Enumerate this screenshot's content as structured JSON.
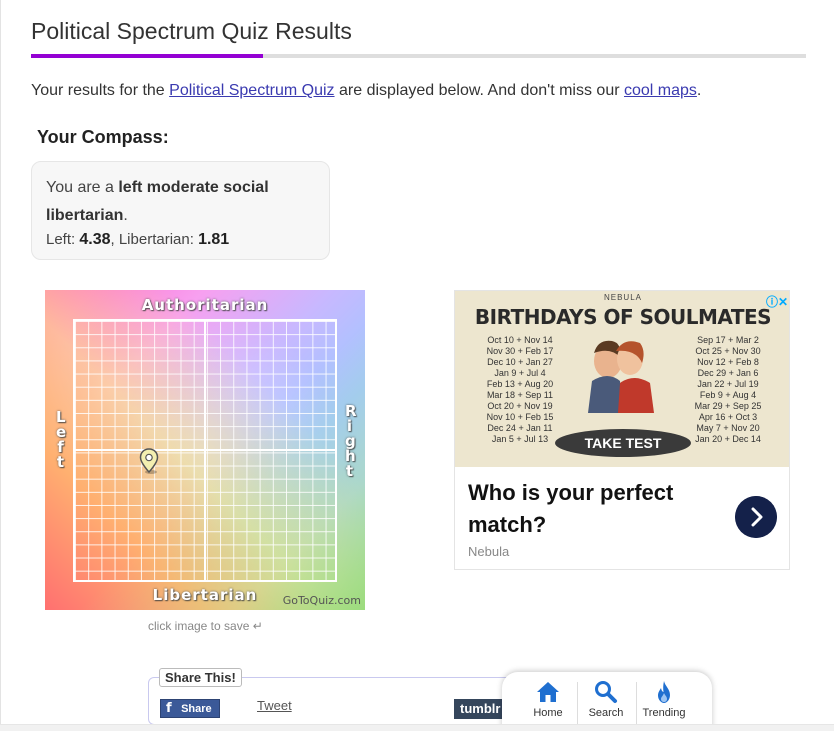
{
  "page": {
    "title": "Political Spectrum Quiz Results",
    "intro_before": "Your results for the ",
    "intro_link1": "Political Spectrum Quiz",
    "intro_middle": " are displayed below. And don't miss our ",
    "intro_link2": "cool maps",
    "intro_after": "."
  },
  "compass": {
    "heading": "Your Compass:",
    "result_prefix": "You are a ",
    "result_bold": "left moderate social libertarian",
    "result_suffix": ".",
    "left_label": "Left: ",
    "left_value": "4.38",
    "sep": ", ",
    "lib_label": "Libertarian: ",
    "lib_value": "1.81"
  },
  "chart": {
    "top_label": "Authoritarian",
    "bottom_label": "Libertarian",
    "left_label": "Left",
    "right_label": "Right",
    "brand": "GoToQuiz.com",
    "save_hint": "click image to save"
  },
  "ad": {
    "brand": "NEBULA",
    "headline": "BIRTHDAYS OF SOULMATES",
    "dates_left": [
      "Oct 10 + Nov 14",
      "Nov 30 + Feb 17",
      "Dec 10 + Jan 27",
      "Jan 9 + Jul 4",
      "Feb 13 + Aug 20",
      "Mar 18 + Sep 11",
      "Oct 20 + Nov 19",
      "Nov 10 + Feb 15",
      "Dec 24 + Jan 11",
      "Jan 5 + Jul 13"
    ],
    "dates_right": [
      "Sep 17 + Mar 2",
      "Oct 25 + Nov 30",
      "Nov 12 + Feb 8",
      "Dec 29 + Jan 6",
      "Jan 22 + Jul 19",
      "Feb 9 + Aug 4",
      "Mar 29 + Sep 25",
      "Apr 16 + Oct 3",
      "May 7 + Nov 20",
      "Jan 20 + Dec 14"
    ],
    "cta": "TAKE TEST",
    "question": "Who is your perfect match?",
    "source": "Nebula"
  },
  "share": {
    "legend": "Share This!",
    "facebook": "Share",
    "tweet": "Tweet",
    "tumblr": "tumblr"
  },
  "nav": {
    "home": "Home",
    "search": "Search",
    "trending": "Trending"
  }
}
